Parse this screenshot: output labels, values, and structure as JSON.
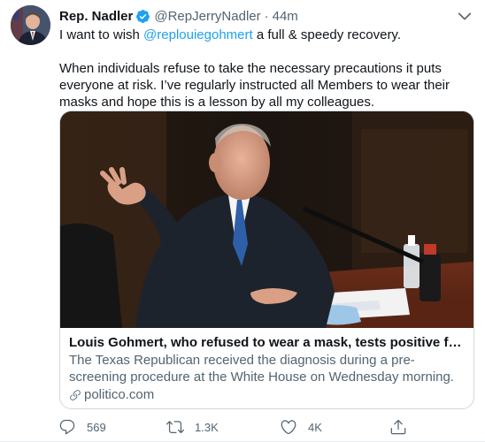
{
  "tweet": {
    "display_name": "Rep. Nadler",
    "handle": "@RepJerryNadler",
    "separator": "·",
    "time": "44m",
    "line1_prefix": "I want to wish ",
    "mention": "@replouiegohmert",
    "line1_suffix": " a full & speedy recovery.",
    "paragraph2": "When individuals refuse to take the necessary precautions it puts everyone at risk. I’ve regularly instructed all Members to wear their masks and hope this is a lesson by all my colleagues."
  },
  "card": {
    "title": "Louis Gohmert, who refused to wear a mask, tests positive for coronavirus",
    "description": "The Texas Republican received the diagnosis during a pre-screening procedure at the White House on Wednesday morning.",
    "domain": "politico.com"
  },
  "actions": {
    "replies": "569",
    "retweets": "1.3K",
    "likes": "4K"
  },
  "colors": {
    "accent": "#1da1f2",
    "secondary_text": "#536471",
    "border": "#cfd9de"
  },
  "icons": [
    "verified-badge-icon",
    "chevron-down-icon",
    "reply-icon",
    "retweet-icon",
    "like-icon",
    "share-icon",
    "link-icon"
  ]
}
